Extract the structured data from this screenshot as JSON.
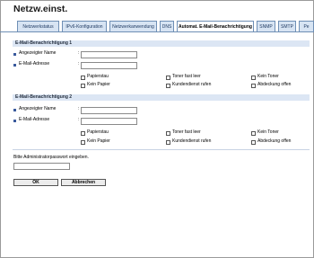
{
  "title": "Netzw.einst.",
  "tabs": [
    {
      "label": "Netzwerkstatus"
    },
    {
      "label": "IPv6-Konfiguration"
    },
    {
      "label": "Netzwerkanwendung"
    },
    {
      "label": "DNS"
    },
    {
      "label": "Automat. E-Mail-Benachrichtigung"
    },
    {
      "label": "SNMP"
    },
    {
      "label": "SMTP"
    },
    {
      "label": "Pe"
    }
  ],
  "sections": [
    {
      "header": "E-Mail-Benachrichtigung 1",
      "name_label": "Angezeigter Name",
      "email_label": "E-Mail-Adresse",
      "name_value": "",
      "email_value": "",
      "checks": [
        "Papierstau",
        "Toner fast leer",
        "Kein Toner",
        "Kein Papier",
        "Kundendienst rufen",
        "Abdeckung offen"
      ]
    },
    {
      "header": "E-Mail-Benachrichtigung 2",
      "name_label": "Angezeigter Name",
      "email_label": "E-Mail-Adresse",
      "name_value": "",
      "email_value": "",
      "checks": [
        "Papierstau",
        "Toner fast leer",
        "Kein Toner",
        "Kein Papier",
        "Kundendienst rufen",
        "Abdeckung offen"
      ]
    }
  ],
  "admin_prompt": "Bitte Administratorpasswort eingeben.",
  "buttons": {
    "ok": "OK",
    "cancel": "Abbrechen"
  }
}
